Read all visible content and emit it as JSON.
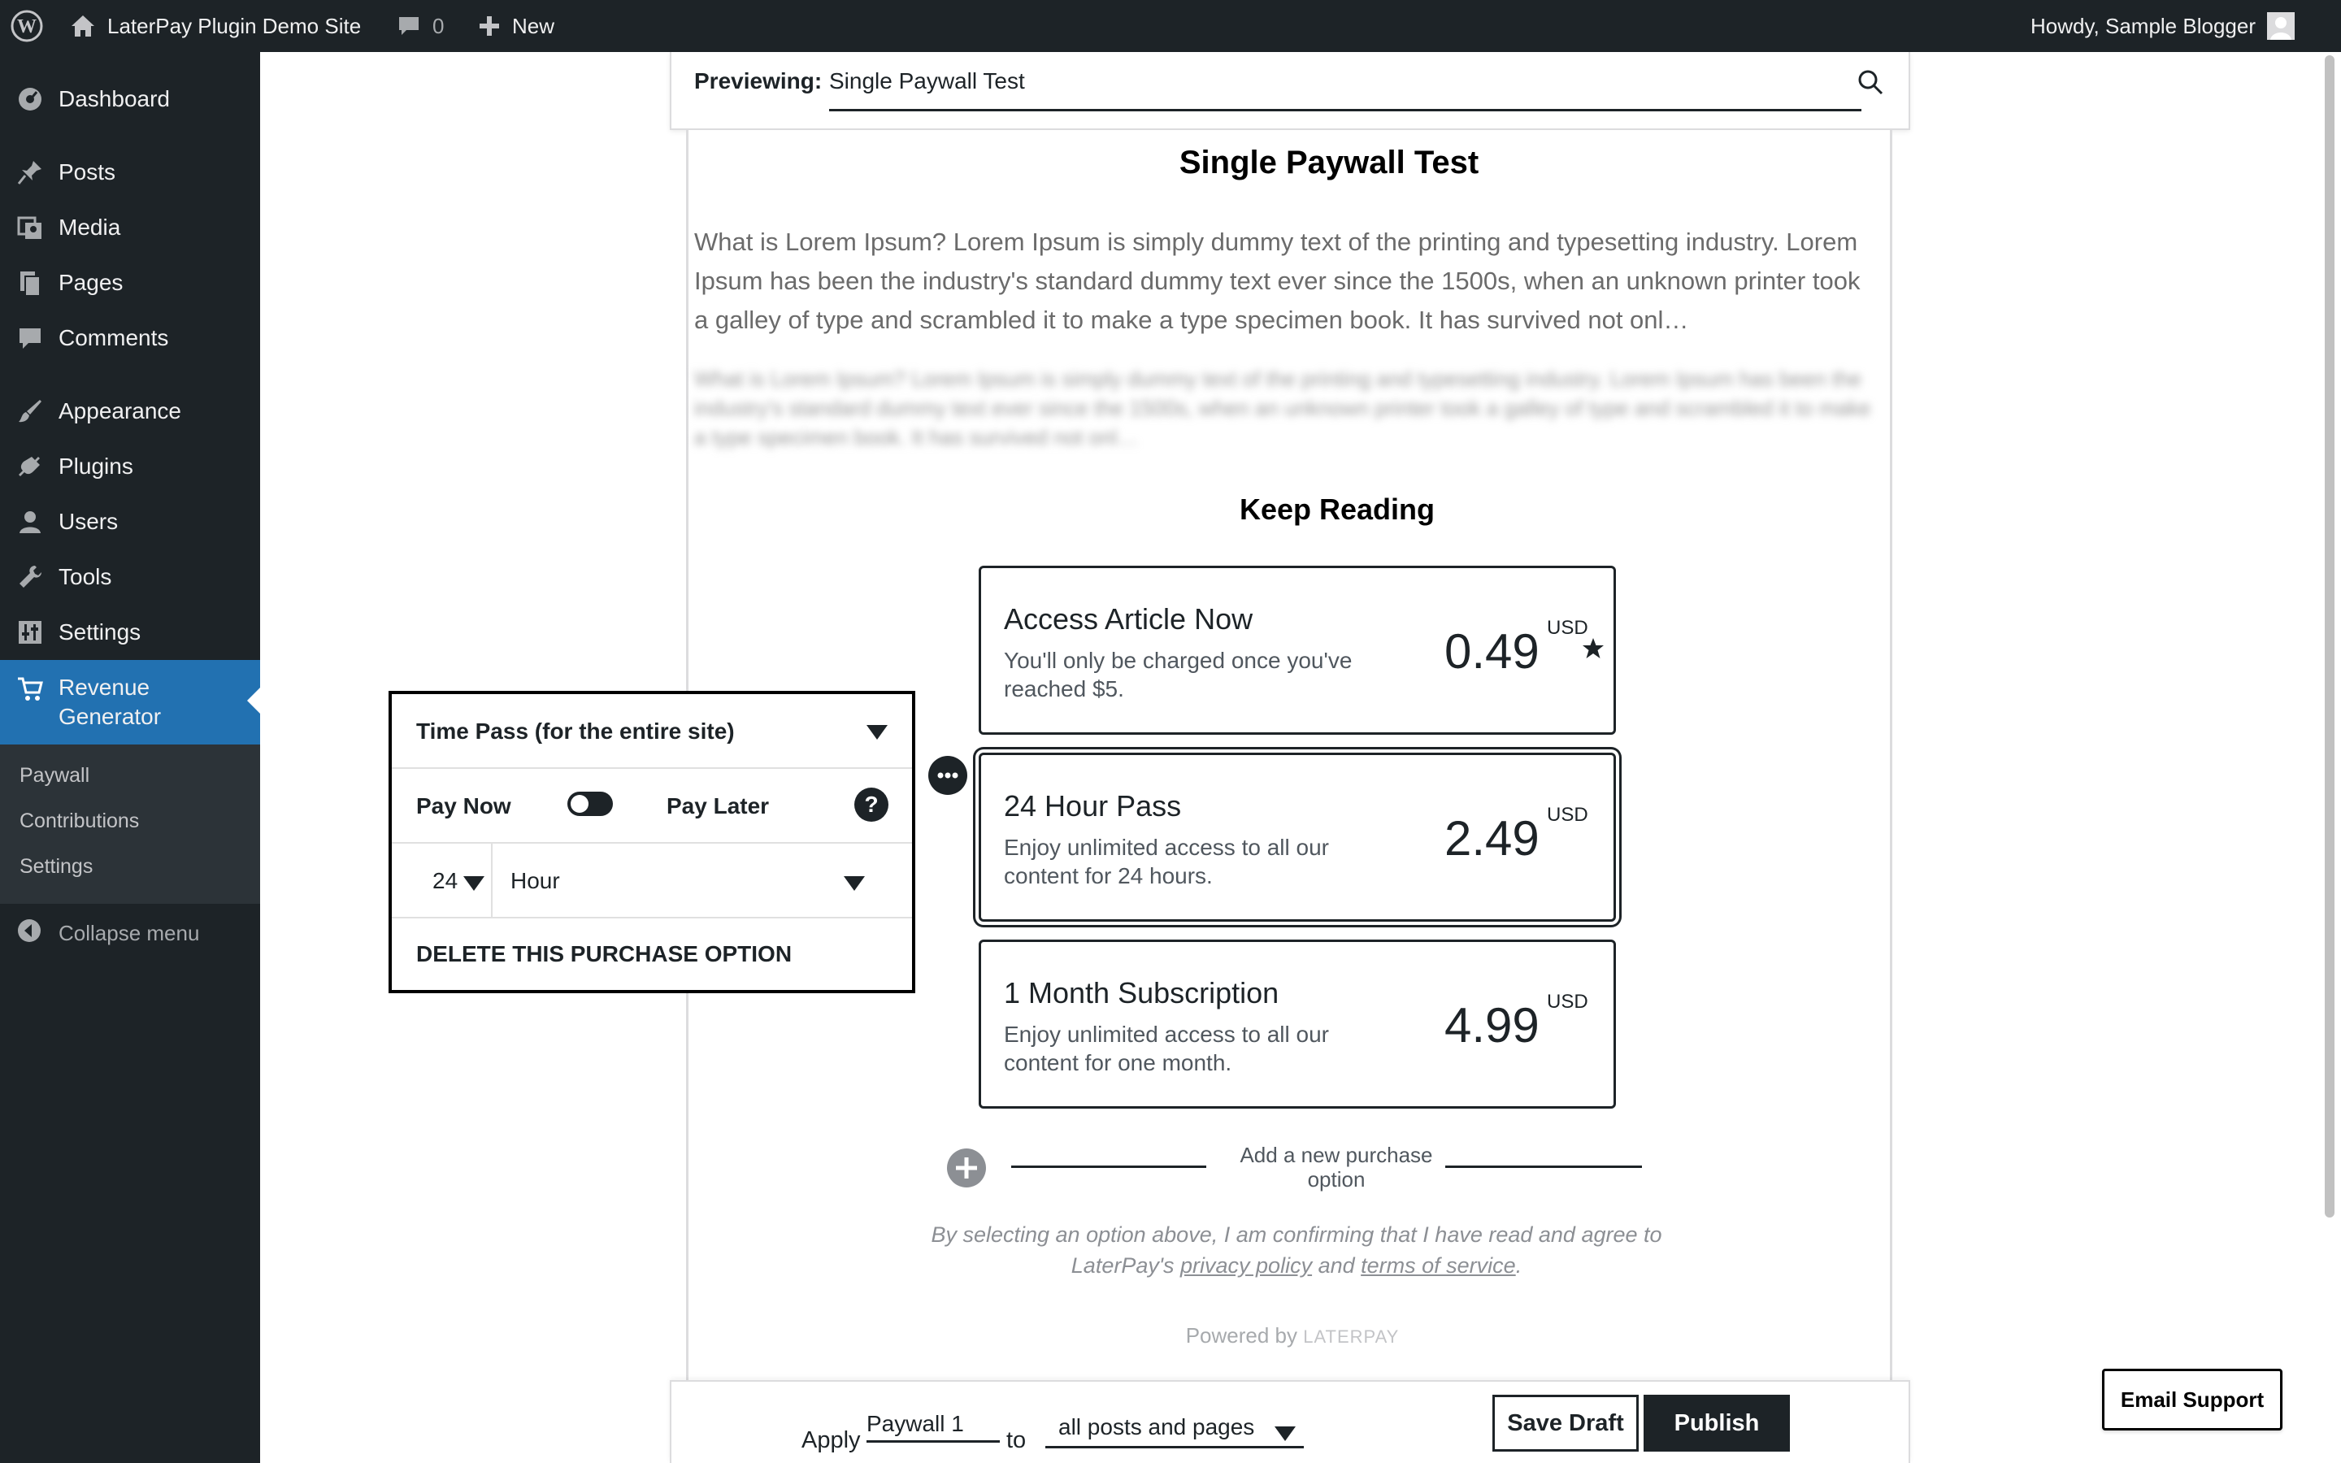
{
  "adminbar": {
    "site_name": "LaterPay Plugin Demo Site",
    "comments_count": "0",
    "new_label": "New",
    "greeting": "Howdy, Sample Blogger"
  },
  "sidebar": {
    "items": [
      {
        "label": "Dashboard",
        "icon": "dashboard-icon"
      },
      {
        "label": "Posts",
        "icon": "pushpin-icon"
      },
      {
        "label": "Media",
        "icon": "media-icon"
      },
      {
        "label": "Pages",
        "icon": "pages-icon"
      },
      {
        "label": "Comments",
        "icon": "comment-icon"
      },
      {
        "label": "Appearance",
        "icon": "paintbrush-icon"
      },
      {
        "label": "Plugins",
        "icon": "plug-icon"
      },
      {
        "label": "Users",
        "icon": "user-icon"
      },
      {
        "label": "Tools",
        "icon": "wrench-icon"
      },
      {
        "label": "Settings",
        "icon": "sliders-icon"
      },
      {
        "label": "Revenue Generator",
        "icon": "cart-icon"
      }
    ],
    "submenu": [
      "Paywall",
      "Contributions",
      "Settings"
    ],
    "collapse_label": "Collapse menu"
  },
  "preview": {
    "label": "Previewing:",
    "value": "Single Paywall Test"
  },
  "article": {
    "title": "Single Paywall Test",
    "excerpt": "What is Lorem Ipsum? Lorem Ipsum is simply dummy text of the printing and typesetting industry. Lorem Ipsum has been the industry's standard dummy text ever since the 1500s, when an unknown printer took a galley of type and scrambled it to make a type specimen book. It has survived not onl…",
    "blurred": "What is Lorem Ipsum? Lorem Ipsum is simply dummy text of the printing and typesetting industry. Lorem Ipsum has been the industry's standard dummy text ever since the 1500s, when an unknown printer took a galley of type and scrambled it to make a type specimen book. It has survived not onl…"
  },
  "paywall": {
    "heading": "Keep Reading",
    "options": [
      {
        "title": "Access Article Now",
        "description": "You'll only be charged once you've reached $5.",
        "price": "0.49",
        "currency": "USD"
      },
      {
        "title": "24 Hour Pass",
        "description": "Enjoy unlimited access to all our content for 24 hours.",
        "price": "2.49",
        "currency": "USD"
      },
      {
        "title": "1 Month Subscription",
        "description": "Enjoy unlimited access to all our content for one month.",
        "price": "4.99",
        "currency": "USD"
      }
    ],
    "add_new": "Add a new purchase option",
    "consent_before": "By selecting an option above, I am confirming that I have read and agree to LaterPay's ",
    "privacy_link": "privacy policy",
    "consent_and": " and ",
    "terms_link": "terms of service",
    "consent_end": ".",
    "powered_by": "Powered by",
    "powered_brand": "LATERPAY"
  },
  "editor": {
    "type_value": "Time Pass (for the entire site)",
    "pay_now": "Pay Now",
    "pay_later": "Pay Later",
    "duration_value": "24",
    "period_value": "Hour",
    "delete_label": "DELETE THIS PURCHASE OPTION"
  },
  "bottombar": {
    "apply_label": "Apply",
    "paywall_name": "Paywall 1",
    "to_label": "to",
    "scope_value": "all posts and pages",
    "save_draft": "Save Draft",
    "publish": "Publish"
  },
  "email_support": "Email Support",
  "colors": {
    "admin_dark": "#1d2327",
    "accent_blue": "#2271b1"
  }
}
